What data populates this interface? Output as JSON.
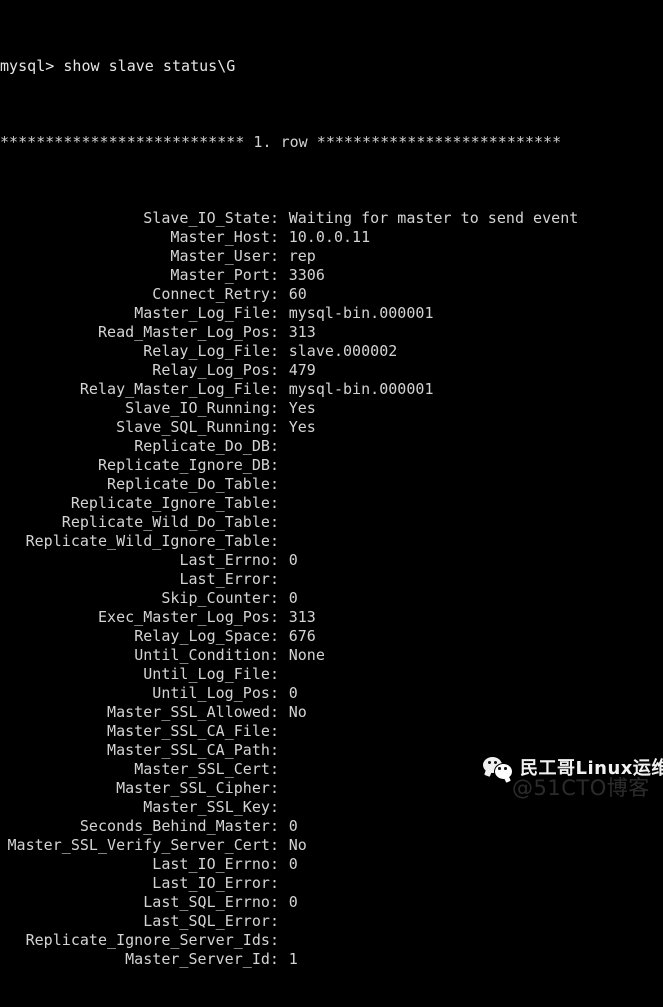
{
  "terminal": {
    "prompt_line": "mysql> show slave status\\G",
    "row_separator": "*************************** 1. row ***************************",
    "fields": [
      {
        "label": "Slave_IO_State",
        "value": "Waiting for master to send event"
      },
      {
        "label": "Master_Host",
        "value": "10.0.0.11"
      },
      {
        "label": "Master_User",
        "value": "rep"
      },
      {
        "label": "Master_Port",
        "value": "3306"
      },
      {
        "label": "Connect_Retry",
        "value": "60"
      },
      {
        "label": "Master_Log_File",
        "value": "mysql-bin.000001"
      },
      {
        "label": "Read_Master_Log_Pos",
        "value": "313"
      },
      {
        "label": "Relay_Log_File",
        "value": "slave.000002"
      },
      {
        "label": "Relay_Log_Pos",
        "value": "479"
      },
      {
        "label": "Relay_Master_Log_File",
        "value": "mysql-bin.000001"
      },
      {
        "label": "Slave_IO_Running",
        "value": "Yes"
      },
      {
        "label": "Slave_SQL_Running",
        "value": "Yes"
      },
      {
        "label": "Replicate_Do_DB",
        "value": ""
      },
      {
        "label": "Replicate_Ignore_DB",
        "value": ""
      },
      {
        "label": "Replicate_Do_Table",
        "value": ""
      },
      {
        "label": "Replicate_Ignore_Table",
        "value": ""
      },
      {
        "label": "Replicate_Wild_Do_Table",
        "value": ""
      },
      {
        "label": "Replicate_Wild_Ignore_Table",
        "value": ""
      },
      {
        "label": "Last_Errno",
        "value": "0"
      },
      {
        "label": "Last_Error",
        "value": ""
      },
      {
        "label": "Skip_Counter",
        "value": "0"
      },
      {
        "label": "Exec_Master_Log_Pos",
        "value": "313"
      },
      {
        "label": "Relay_Log_Space",
        "value": "676"
      },
      {
        "label": "Until_Condition",
        "value": "None"
      },
      {
        "label": "Until_Log_File",
        "value": ""
      },
      {
        "label": "Until_Log_Pos",
        "value": "0"
      },
      {
        "label": "Master_SSL_Allowed",
        "value": "No"
      },
      {
        "label": "Master_SSL_CA_File",
        "value": ""
      },
      {
        "label": "Master_SSL_CA_Path",
        "value": ""
      },
      {
        "label": "Master_SSL_Cert",
        "value": ""
      },
      {
        "label": "Master_SSL_Cipher",
        "value": ""
      },
      {
        "label": "Master_SSL_Key",
        "value": ""
      },
      {
        "label": "Seconds_Behind_Master",
        "value": "0"
      },
      {
        "label": "Master_SSL_Verify_Server_Cert",
        "value": "No"
      },
      {
        "label": "Last_IO_Errno",
        "value": "0"
      },
      {
        "label": "Last_IO_Error",
        "value": ""
      },
      {
        "label": "Last_SQL_Errno",
        "value": "0"
      },
      {
        "label": "Last_SQL_Error",
        "value": ""
      },
      {
        "label": "Replicate_Ignore_Server_Ids",
        "value": ""
      },
      {
        "label": "Master_Server_Id",
        "value": "1"
      }
    ]
  },
  "watermark": {
    "brand_text": "民工哥Linux运维",
    "site_text": "@51CTO博客"
  },
  "colors": {
    "background": "#000000",
    "foreground": "#d4d4d4"
  }
}
